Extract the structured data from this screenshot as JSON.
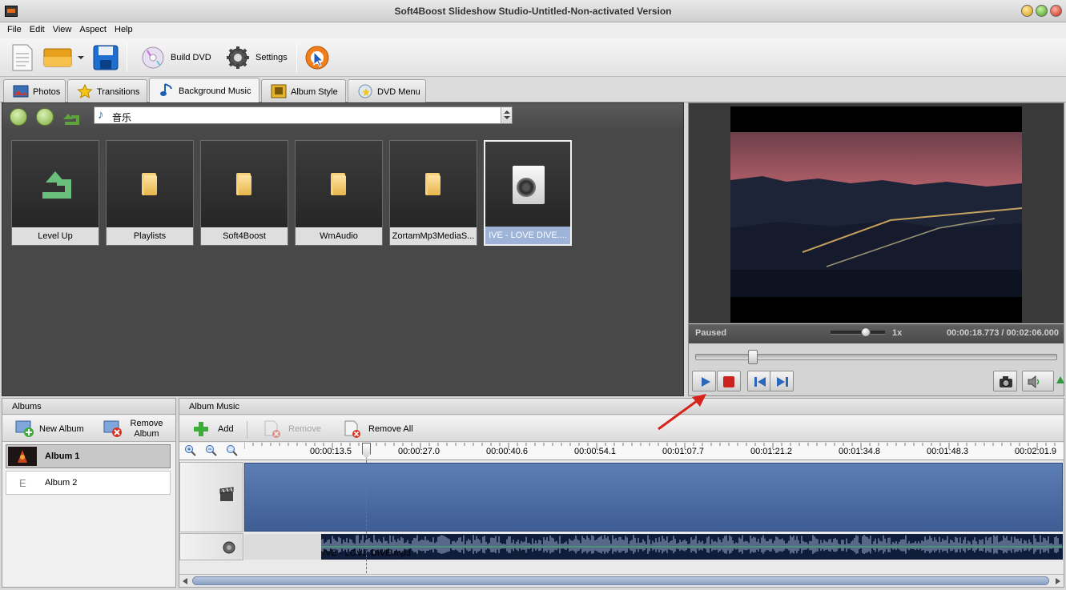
{
  "window": {
    "title": "Soft4Boost Slideshow Studio-Untitled-Non-activated Version"
  },
  "menu": [
    "File",
    "Edit",
    "View",
    "Aspect",
    "Help"
  ],
  "toolbar": {
    "build_dvd": "Build DVD",
    "settings": "Settings"
  },
  "tabs": [
    "Photos",
    "Transitions",
    "Background Music",
    "Album Style",
    "DVD Menu"
  ],
  "active_tab": "Background Music",
  "browser": {
    "path": "音乐",
    "items": [
      {
        "label": "Level Up",
        "type": "up-icon"
      },
      {
        "label": "Playlists",
        "type": "folder-icon"
      },
      {
        "label": "Soft4Boost",
        "type": "folder-icon"
      },
      {
        "label": "WmAudio",
        "type": "folder-icon"
      },
      {
        "label": "ZortamMp3MediaS...",
        "type": "folder-icon"
      },
      {
        "label": "IVE - LOVE DIVE....",
        "type": "audio-file-icon",
        "selected": true
      }
    ]
  },
  "preview": {
    "status": "Paused",
    "speed": "1x",
    "time": "00:00:18.773  /  00:02:06.000",
    "seek_fraction": 0.149
  },
  "albums": {
    "header": "Albums",
    "new_album": "New Album",
    "remove_album": "Remove Album",
    "items": [
      {
        "label": "Album 1",
        "selected": true
      },
      {
        "label": "Album 2",
        "selected": false
      }
    ]
  },
  "album_music": {
    "header": "Album Music",
    "add": "Add",
    "remove": "Remove",
    "remove_all": "Remove All",
    "ruler_ticks": [
      "00:00:13.5",
      "00:00:27.0",
      "00:00:40.6",
      "00:00:54.1",
      "00:01:07.7",
      "00:01:21.2",
      "00:01:34.8",
      "00:01:48.3",
      "00:02:01.9"
    ],
    "audio_clip_name": "IVE - LOVE DIVE.mp3"
  },
  "colors": {
    "accent_red": "#c8231f",
    "timeline_blue": "#4a6aa3"
  }
}
